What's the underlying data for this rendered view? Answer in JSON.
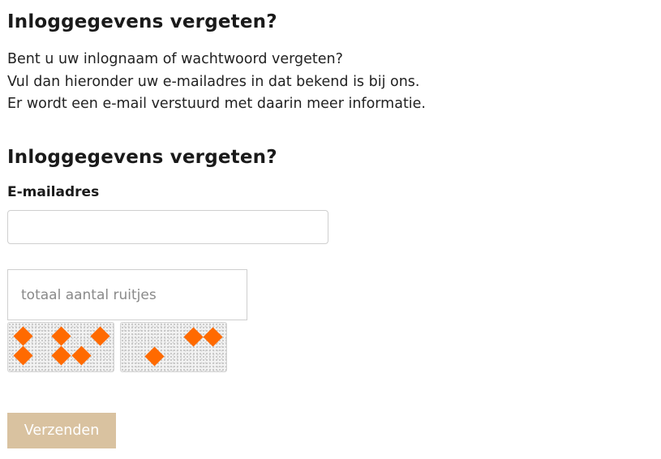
{
  "section1": {
    "title": "Inloggegevens vergeten?",
    "lines": [
      "Bent u uw inlognaam of wachtwoord vergeten?",
      "Vul dan hieronder uw e-mailadres in dat bekend is bij ons.",
      "Er wordt een e-mail verstuurd met daarin meer informatie."
    ]
  },
  "form": {
    "title": "Inloggegevens vergeten?",
    "email_label": "E-mailadres",
    "email_value": "",
    "captcha_placeholder": "totaal aantal ruitjes",
    "captcha_value": "",
    "submit_label": "Verzenden"
  },
  "captcha": {
    "diamond_color": "#ff6a00",
    "tiles": [
      {
        "diamond_count": 6
      },
      {
        "diamond_count": 3
      }
    ]
  },
  "colors": {
    "button_bg": "#d9c2a0",
    "text": "#1a1a1a",
    "input_border": "#cfcfcf"
  }
}
